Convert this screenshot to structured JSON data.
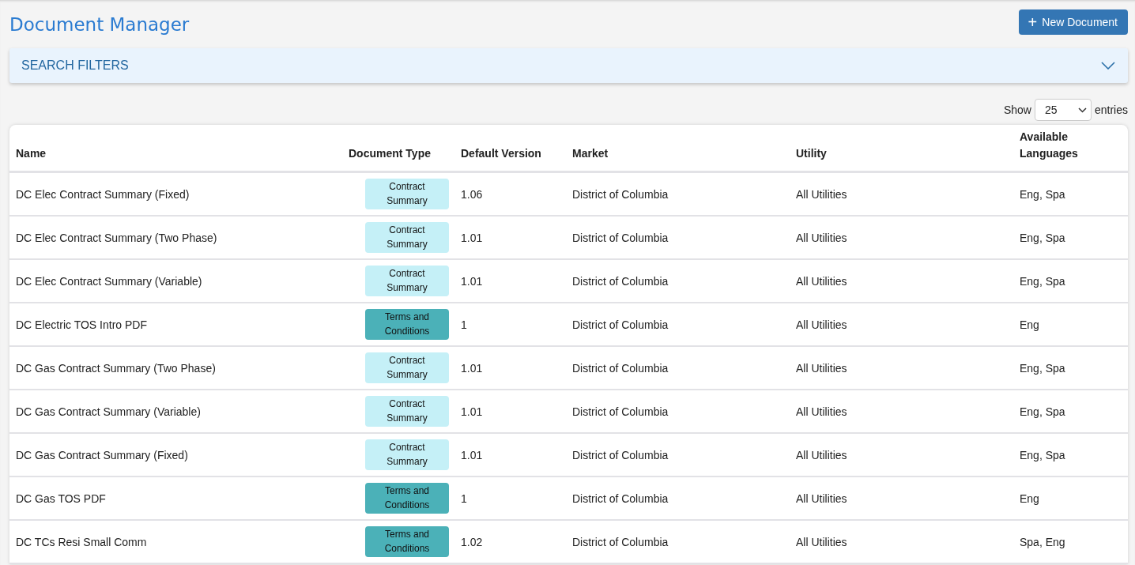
{
  "title": "Document Manager",
  "new_button": {
    "icon": "+",
    "label": "New Document"
  },
  "search_filters": {
    "label": "SEARCH FILTERS",
    "expanded": false
  },
  "page_size": {
    "prefix": "Show",
    "value": "25",
    "suffix": "entries"
  },
  "table": {
    "columns": [
      "Name",
      "Document Type",
      "Default Version",
      "Market",
      "Utility",
      "Available Languages"
    ],
    "rows": [
      {
        "name": "DC Elec Contract Summary (Fixed)",
        "doc_type": {
          "label": "Contract Summary",
          "color": "#c5f0f7"
        },
        "version": "1.06",
        "market": "District of Columbia",
        "utility": "All Utilities",
        "languages": "Eng, Spa"
      },
      {
        "name": "DC Elec Contract Summary (Two Phase)",
        "doc_type": {
          "label": "Contract Summary",
          "color": "#c5f0f7"
        },
        "version": "1.01",
        "market": "District of Columbia",
        "utility": "All Utilities",
        "languages": "Eng, Spa"
      },
      {
        "name": "DC Elec Contract Summary (Variable)",
        "doc_type": {
          "label": "Contract Summary",
          "color": "#c5f0f7"
        },
        "version": "1.01",
        "market": "District of Columbia",
        "utility": "All Utilities",
        "languages": "Eng, Spa"
      },
      {
        "name": "DC Electric TOS Intro PDF",
        "doc_type": {
          "label": "Terms and Conditions",
          "color": "#4bb1b8"
        },
        "version": "1",
        "market": "District of Columbia",
        "utility": "All Utilities",
        "languages": "Eng"
      },
      {
        "name": "DC Gas Contract Summary (Two Phase)",
        "doc_type": {
          "label": "Contract Summary",
          "color": "#c5f0f7"
        },
        "version": "1.01",
        "market": "District of Columbia",
        "utility": "All Utilities",
        "languages": "Eng, Spa"
      },
      {
        "name": "DC Gas Contract Summary (Variable)",
        "doc_type": {
          "label": "Contract Summary",
          "color": "#c5f0f7"
        },
        "version": "1.01",
        "market": "District of Columbia",
        "utility": "All Utilities",
        "languages": "Eng, Spa"
      },
      {
        "name": "DC Gas Contract Summary (Fixed)",
        "doc_type": {
          "label": "Contract Summary",
          "color": "#c5f0f7"
        },
        "version": "1.01",
        "market": "District of Columbia",
        "utility": "All Utilities",
        "languages": "Eng, Spa"
      },
      {
        "name": "DC Gas TOS PDF",
        "doc_type": {
          "label": "Terms and Conditions",
          "color": "#4bb1b8"
        },
        "version": "1",
        "market": "District of Columbia",
        "utility": "All Utilities",
        "languages": "Eng"
      },
      {
        "name": "DC TCs Resi Small Comm",
        "doc_type": {
          "label": "Terms and Conditions",
          "color": "#4bb1b8"
        },
        "version": "1.02",
        "market": "District of Columbia",
        "utility": "All Utilities",
        "languages": "Spa, Eng"
      }
    ]
  }
}
